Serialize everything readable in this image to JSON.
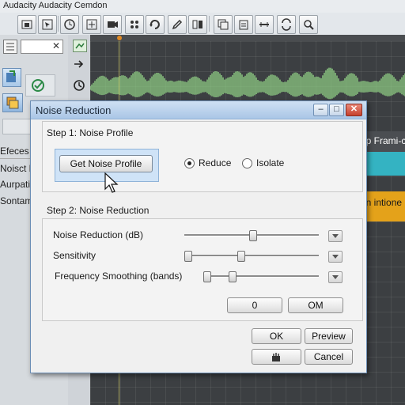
{
  "window": {
    "title": "Audacity Audacity  Cemdon"
  },
  "sidebar": {
    "items": [
      {
        "label": "Efeces"
      },
      {
        "label": "Noisct E"
      },
      {
        "label": "Aurpatio"
      },
      {
        "label": "Sontams"
      }
    ]
  },
  "tracks": {
    "labels": [
      "ep Frami-c",
      "on intione"
    ],
    "colors": {
      "waveform": "#8fce84",
      "highlight": "#34b3c2",
      "accent": "#e4a21a"
    }
  },
  "dialog": {
    "title": "Noise Reduction",
    "step1": {
      "heading": "Step 1: Noise Profile",
      "get_profile_label": "Get Noise Profile",
      "radios": [
        {
          "label": "Reduce",
          "selected": true
        },
        {
          "label": "Isolate",
          "selected": false
        }
      ]
    },
    "step2": {
      "heading": "Step 2: Noise Reduction",
      "sliders": [
        {
          "label": "Noise Reduction (dB)"
        },
        {
          "label": "Sensitivity"
        },
        {
          "label": "Frequency Smoothing (bands)"
        }
      ],
      "buttons": {
        "left": "0",
        "right": "OM"
      }
    },
    "buttons": {
      "ok": "OK",
      "preview": "Preview",
      "cancel": "Cancel"
    }
  }
}
